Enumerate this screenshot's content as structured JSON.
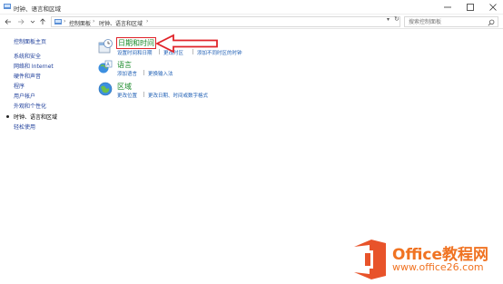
{
  "window": {
    "title": "时钟、语言和区域"
  },
  "address": {
    "crumbs": [
      "控制面板",
      "时钟、语言和区域"
    ],
    "separator": "›",
    "search_placeholder": "搜索控制面板"
  },
  "sidebar": {
    "items": [
      {
        "label": "控制面板主页"
      },
      {
        "label": "系统和安全"
      },
      {
        "label": "网络和 Internet"
      },
      {
        "label": "硬件和声音"
      },
      {
        "label": "程序"
      },
      {
        "label": "用户帐户"
      },
      {
        "label": "外观和个性化"
      },
      {
        "label": "时钟、语言和区域",
        "active": true
      },
      {
        "label": "轻松使用"
      }
    ]
  },
  "categories": [
    {
      "title": "日期和时间",
      "links": [
        "设置时间和日期",
        "更改时区",
        "添加不同时区的时钟"
      ]
    },
    {
      "title": "语言",
      "links": [
        "添加语言",
        "更换输入法"
      ]
    },
    {
      "title": "区域",
      "links": [
        "更改位置",
        "更改日期、时间或数字格式"
      ]
    }
  ],
  "watermark": {
    "brand": "Office教程网",
    "url": "www.office26.com"
  },
  "colors": {
    "link": "#1f5fb5",
    "category_title": "#1a8a2a",
    "highlight": "#e0242a",
    "brand": "#f07322"
  }
}
